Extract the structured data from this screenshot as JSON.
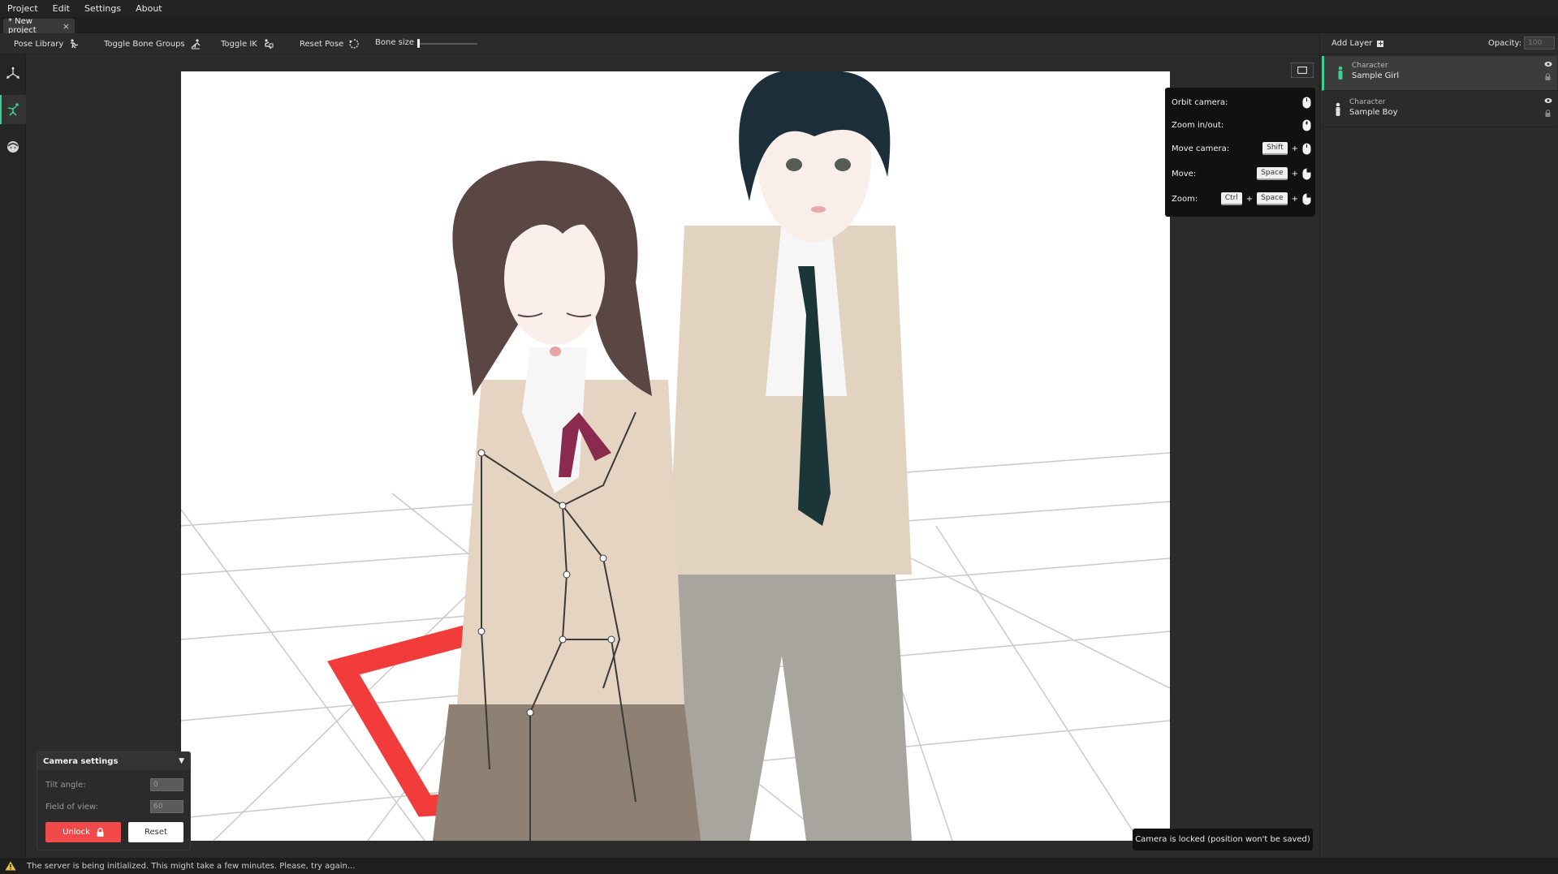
{
  "menu": [
    "Project",
    "Edit",
    "Settings",
    "About"
  ],
  "tab": {
    "label": "* New project",
    "close": "×"
  },
  "toolbar": {
    "pose_library": "Pose Library",
    "toggle_bone_groups": "Toggle Bone Groups",
    "toggle_ik": "Toggle IK",
    "reset_pose": "Reset Pose",
    "bone_size": "Bone size",
    "bone_size_value": 0
  },
  "layers_panel": {
    "add_layer": "Add Layer",
    "opacity_label": "Opacity:",
    "opacity_placeholder": "100",
    "layers": [
      {
        "type": "Character",
        "name": "Sample Girl",
        "active": true
      },
      {
        "type": "Character",
        "name": "Sample Boy",
        "active": false
      }
    ]
  },
  "controls_help": [
    {
      "label": "Orbit camera:",
      "keys": [],
      "mouse": "left-click"
    },
    {
      "label": "Zoom in/out:",
      "keys": [],
      "mouse": "scroll"
    },
    {
      "label": "Move camera:",
      "keys": [
        "Shift"
      ],
      "mouse": "left-click"
    },
    {
      "label": "Move:",
      "keys": [
        "Space"
      ],
      "mouse": "right-click"
    },
    {
      "label": "Zoom:",
      "keys": [
        "Ctrl",
        "Space"
      ],
      "mouse": "right-click"
    }
  ],
  "camera_settings": {
    "title": "Camera settings",
    "tilt_label": "Tilt angle:",
    "tilt_value": "0",
    "fov_label": "Field of view:",
    "fov_value": "60",
    "unlock": "Unlock",
    "reset": "Reset"
  },
  "toast": "Camera is locked (position won't be saved)",
  "status": "The server is being initialized. This might take a few minutes. Please, try again...",
  "colors": {
    "accent": "#3ccf91",
    "danger": "#f24a4a",
    "background": "#2b2b2b",
    "viewport": "#ffffff"
  },
  "icons": {
    "sidebar": [
      "transform-gizmo-icon",
      "pose-figure-icon",
      "face-icon"
    ],
    "toolbar": [
      "pose-library-icon",
      "bone-groups-icon",
      "ik-icon",
      "reset-pose-icon"
    ]
  }
}
